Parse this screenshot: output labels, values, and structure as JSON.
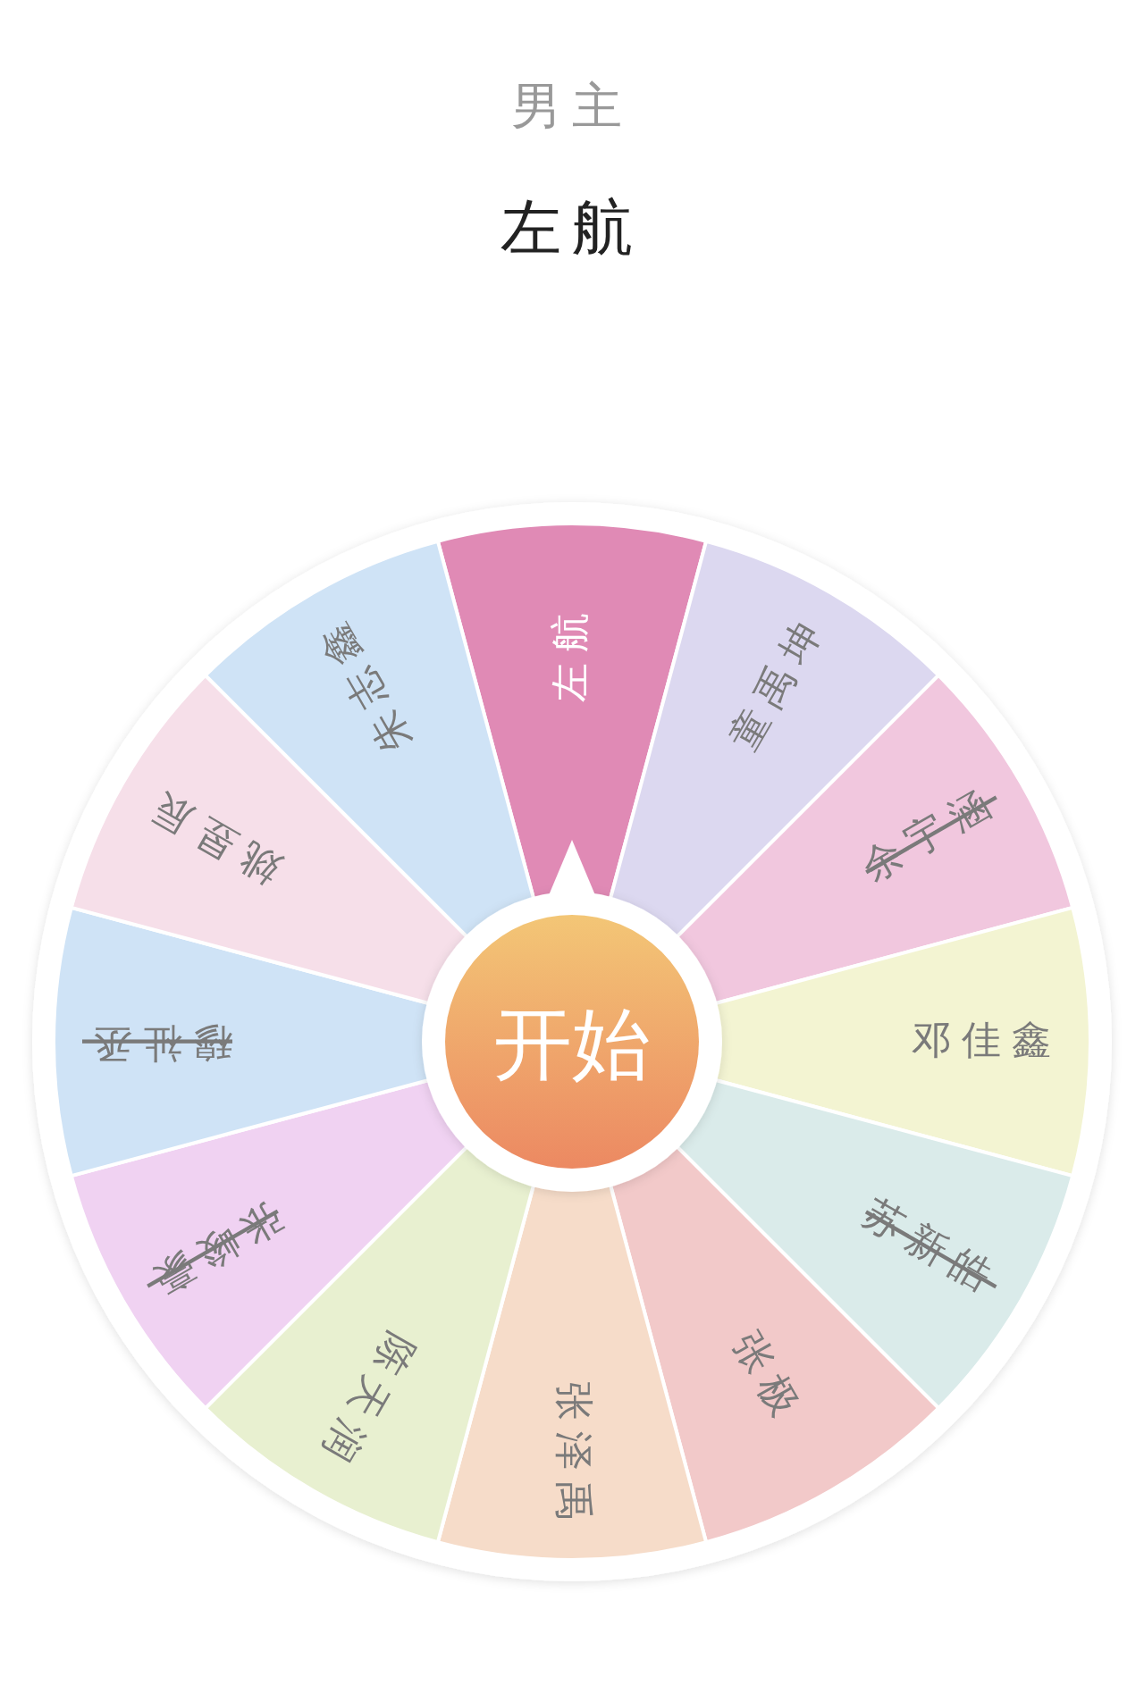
{
  "header": {
    "category": "男主",
    "result": "左航"
  },
  "wheel": {
    "start_button": "开始",
    "segments": [
      {
        "name": "左航",
        "color": "#e08ab5",
        "selected": true,
        "eliminated": false
      },
      {
        "name": "童禹坤",
        "color": "#dcd8f0",
        "selected": false,
        "eliminated": false
      },
      {
        "name": "余宇涵",
        "color": "#f1c7de",
        "selected": false,
        "eliminated": true
      },
      {
        "name": "邓佳鑫",
        "color": "#f3f4d2",
        "selected": false,
        "eliminated": false
      },
      {
        "name": "苏新皓",
        "color": "#daebea",
        "selected": false,
        "eliminated": true
      },
      {
        "name": "张极",
        "color": "#f2c9c9",
        "selected": false,
        "eliminated": false
      },
      {
        "name": "张泽禹",
        "color": "#f6dcc9",
        "selected": false,
        "eliminated": false
      },
      {
        "name": "陈天润",
        "color": "#e8f0d0",
        "selected": false,
        "eliminated": false
      },
      {
        "name": "张峻豪",
        "color": "#f0d2f2",
        "selected": false,
        "eliminated": true
      },
      {
        "name": "穆祉丞",
        "color": "#cfe3f6",
        "selected": false,
        "eliminated": true
      },
      {
        "name": "姚昱辰",
        "color": "#f6dfe9",
        "selected": false,
        "eliminated": false
      },
      {
        "name": "朱志鑫",
        "color": "#cfe3f6",
        "selected": false,
        "eliminated": false
      }
    ]
  }
}
